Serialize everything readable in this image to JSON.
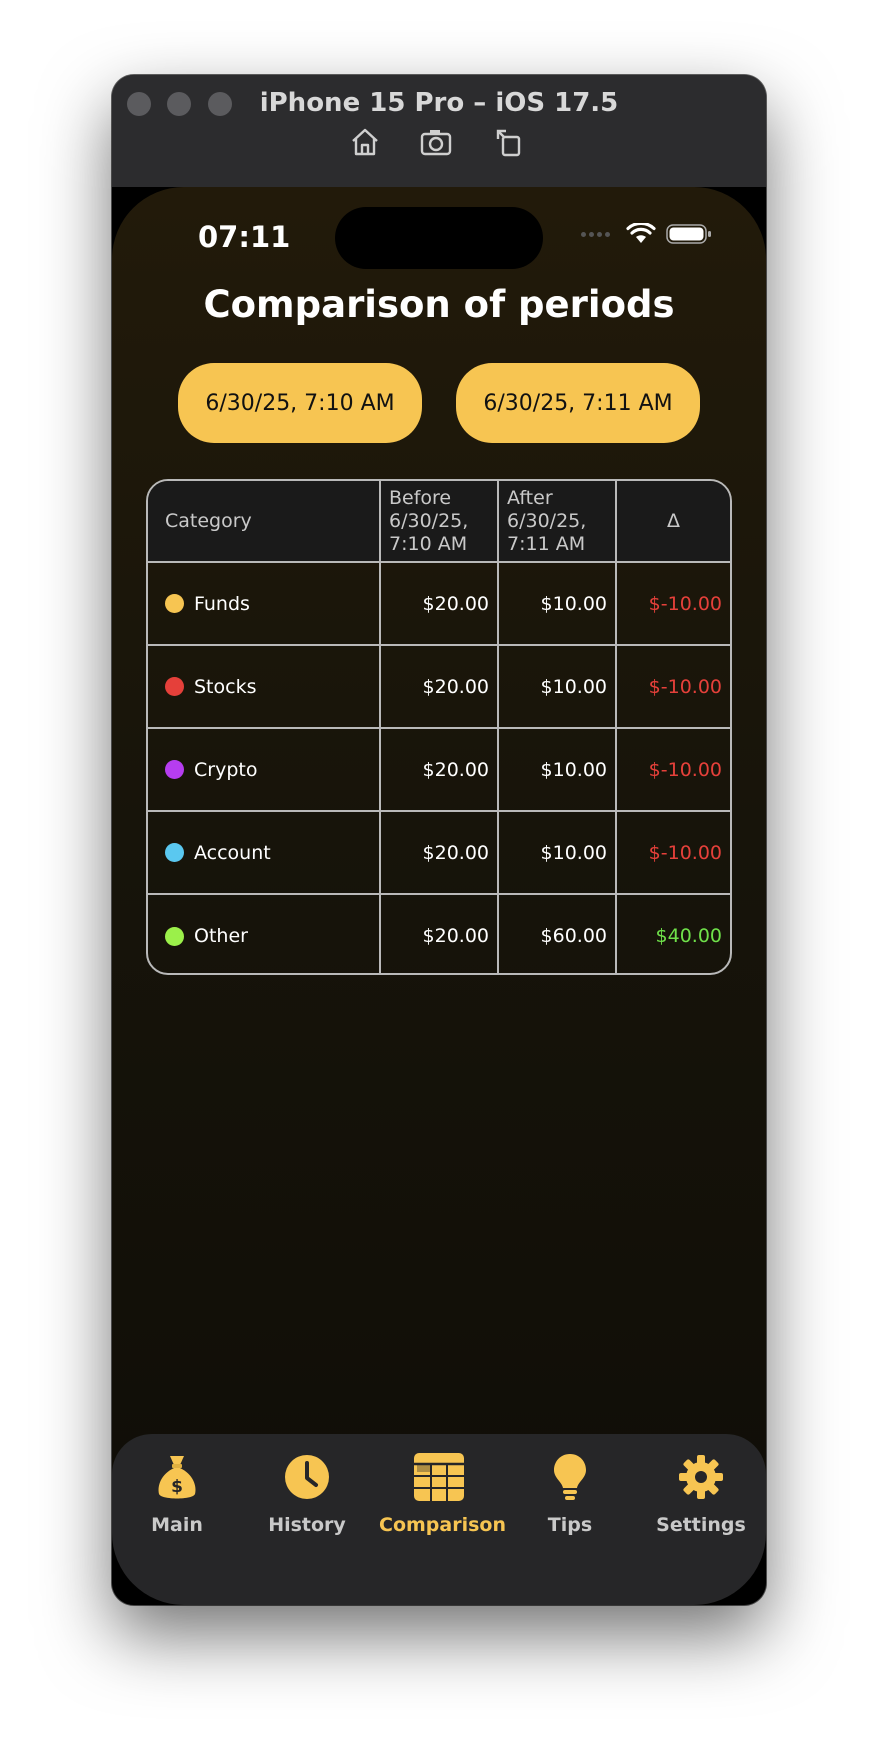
{
  "window": {
    "title": "iPhone 15 Pro – iOS 17.5"
  },
  "status_bar": {
    "time": "07:11"
  },
  "page": {
    "title": "Comparison of periods"
  },
  "period_buttons": {
    "start": "6/30/25, 7:10 AM",
    "end": "6/30/25, 7:11 AM"
  },
  "table": {
    "headers": {
      "category": "Category",
      "before": [
        "Before",
        "6/30/25,",
        "7:10 AM"
      ],
      "after": [
        "After",
        "6/30/25,",
        "7:11 AM"
      ],
      "delta": "Δ"
    },
    "rows": [
      {
        "name": "Funds",
        "color": "#f7c552",
        "before": "$20.00",
        "after": "$10.00",
        "delta": "$-10.00",
        "sign": "neg"
      },
      {
        "name": "Stocks",
        "color": "#e5403a",
        "before": "$20.00",
        "after": "$10.00",
        "delta": "$-10.00",
        "sign": "neg"
      },
      {
        "name": "Crypto",
        "color": "#b63df0",
        "before": "$20.00",
        "after": "$10.00",
        "delta": "$-10.00",
        "sign": "neg"
      },
      {
        "name": "Account",
        "color": "#5ac8f0",
        "before": "$20.00",
        "after": "$10.00",
        "delta": "$-10.00",
        "sign": "neg"
      },
      {
        "name": "Other",
        "color": "#9bf04a",
        "before": "$20.00",
        "after": "$60.00",
        "delta": "$40.00",
        "sign": "pos"
      }
    ]
  },
  "tabs": [
    {
      "label": "Main",
      "icon": "money-bag-icon"
    },
    {
      "label": "History",
      "icon": "clock-icon"
    },
    {
      "label": "Comparison",
      "icon": "table-icon",
      "active": true
    },
    {
      "label": "Tips",
      "icon": "lightbulb-icon"
    },
    {
      "label": "Settings",
      "icon": "gear-icon"
    }
  ],
  "colors": {
    "accent": "#f7c552",
    "negative": "#e5403a",
    "positive": "#6fe04a"
  }
}
